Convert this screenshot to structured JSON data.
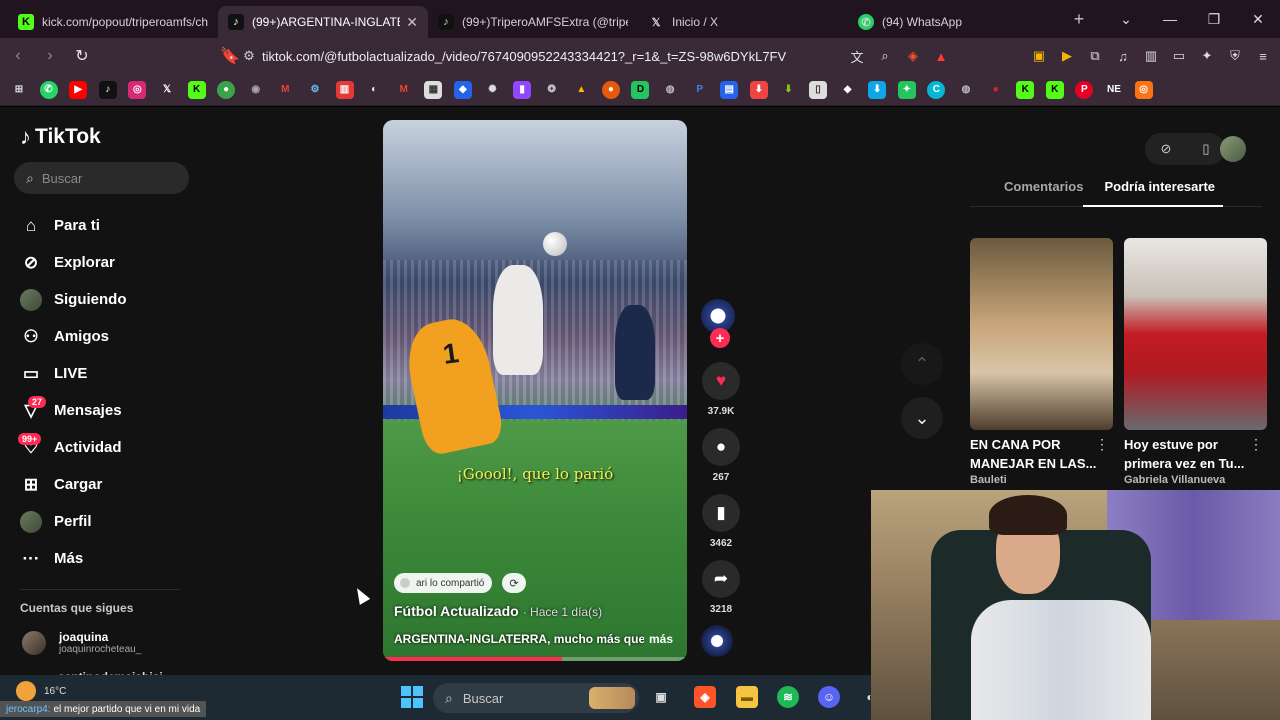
{
  "browser": {
    "tabs": [
      {
        "title": "kick.com/popout/triperoamfs/ch",
        "icon": "kick-icon",
        "color": "#53fc18"
      },
      {
        "title": "(99+)ARGENTINA-INGLATER",
        "icon": "tiktok-icon",
        "color": "#000000"
      },
      {
        "title": "(99+)TriperoAMFSExtra (@triper",
        "icon": "tiktok-icon",
        "color": "#000000"
      },
      {
        "title": "Inicio / X",
        "icon": "x-icon",
        "color": "#000000"
      },
      {
        "title": "(94) WhatsApp",
        "icon": "whatsapp-icon",
        "color": "#25d366"
      }
    ],
    "url": "tiktok.com/@futbolactualizado_/video/7674090952243334421?_r=1&_t=ZS-98w6DYkL7FV"
  },
  "tiktok": {
    "logo_text": "TikTok",
    "search_placeholder": "Buscar",
    "nav": [
      {
        "label": "Para ti",
        "icon": "home-icon"
      },
      {
        "label": "Explorar",
        "icon": "compass-icon"
      },
      {
        "label": "Siguiendo",
        "icon": "following-avatar-icon"
      },
      {
        "label": "Amigos",
        "icon": "friends-icon"
      },
      {
        "label": "LIVE",
        "icon": "live-tv-icon"
      },
      {
        "label": "Mensajes",
        "icon": "messages-icon",
        "badge": "27"
      },
      {
        "label": "Actividad",
        "icon": "activity-icon",
        "badge": "99+"
      },
      {
        "label": "Cargar",
        "icon": "upload-icon"
      },
      {
        "label": "Perfil",
        "icon": "profile-avatar-icon"
      },
      {
        "label": "Más",
        "icon": "more-icon"
      }
    ],
    "following_title": "Cuentas que sigues",
    "following": [
      {
        "name": "joaquina",
        "handle": "joaquinrocheteau_"
      },
      {
        "name": "santinodemaisbisi"
      }
    ],
    "video": {
      "caption_overlay": "¡Goool!, que lo parió",
      "shared_by": "ari lo compartió",
      "author": "Fútbol Actualizado",
      "posted": "· Hace 1 día(s)",
      "description": "ARGENTINA-INGLATERRA, mucho más que",
      "more": "más",
      "progress": 0.59
    },
    "actions": {
      "likes": "37.9K",
      "comments": "267",
      "saves": "3462",
      "shares": "3218"
    },
    "right_tabs": [
      "Comentarios",
      "Podría interesarte"
    ],
    "recommended": [
      {
        "title": "EN CANA POR MANEJAR EN LAS...",
        "author": "Bauleti"
      },
      {
        "title": "Hoy estuve por primera vez en Tu...",
        "author": "Gabriela Villanueva"
      }
    ]
  },
  "taskbar": {
    "temperature": "16°C",
    "search_placeholder": "Buscar",
    "chat_user": "jerocarp4:",
    "chat_message": "el mejor partido que vi en mi vida"
  },
  "colors": {
    "accent": "#fe2c55",
    "bg": "#121212"
  }
}
